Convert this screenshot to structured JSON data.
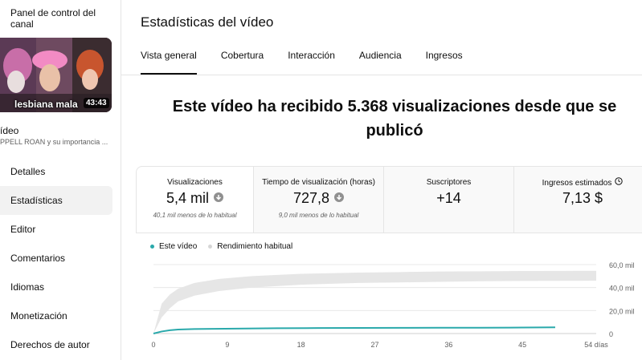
{
  "sidebar": {
    "title": "Panel de control del canal",
    "thumbnail": {
      "overlay_text": "lesbiana mala",
      "duration": "43:43"
    },
    "video_label": "ídeo",
    "video_desc": "PPELL ROAN y su importancia ...",
    "items": [
      {
        "label": "Detalles",
        "active": false
      },
      {
        "label": "Estadísticas",
        "active": true
      },
      {
        "label": "Editor",
        "active": false
      },
      {
        "label": "Comentarios",
        "active": false
      },
      {
        "label": "Idiomas",
        "active": false
      },
      {
        "label": "Monetización",
        "active": false
      },
      {
        "label": "Derechos de autor",
        "active": false
      }
    ]
  },
  "header": {
    "title": "Estadísticas del vídeo"
  },
  "tabs": [
    {
      "label": "Vista general",
      "active": true
    },
    {
      "label": "Cobertura",
      "active": false
    },
    {
      "label": "Interacción",
      "active": false
    },
    {
      "label": "Audiencia",
      "active": false
    },
    {
      "label": "Ingresos",
      "active": false
    }
  ],
  "headline": "Este vídeo ha recibido 5.368 visualizaciones desde que se publicó",
  "cards": [
    {
      "label": "Visualizaciones",
      "value": "5,4 mil",
      "sub": "40,1 mil menos de lo habitual",
      "trend_icon": "arrow-down-icon"
    },
    {
      "label": "Tiempo de visualización (horas)",
      "value": "727,8",
      "sub": "9,0 mil menos de lo habitual",
      "trend_icon": "arrow-down-icon"
    },
    {
      "label": "Suscriptores",
      "value": "+14",
      "sub": ""
    },
    {
      "label": "Ingresos estimados",
      "value": "7,13 $",
      "sub": "",
      "has_info_icon": true
    }
  ],
  "colors": {
    "accent_teal": "#2aa9ab",
    "typical_band": "#e6e6e6"
  },
  "chart_data": {
    "type": "line",
    "legend_placement": "top-left",
    "series": [
      {
        "name": "Este vídeo",
        "color": "#2aa9ab",
        "x": [
          0,
          1,
          2,
          3,
          5,
          10,
          15,
          20,
          25,
          30,
          35,
          40,
          45,
          49
        ],
        "y": [
          0,
          1800,
          2900,
          3500,
          3900,
          4300,
          4600,
          4800,
          4900,
          5000,
          5050,
          5100,
          5200,
          5368
        ]
      },
      {
        "name": "Rendimiento habitual",
        "color": "#e6e6e6",
        "x": [
          0,
          1,
          2,
          3,
          5,
          8,
          12,
          18,
          25,
          30,
          35,
          40,
          45,
          54
        ],
        "y_low": [
          0,
          14000,
          22000,
          28000,
          33000,
          37000,
          40000,
          42500,
          44000,
          44500,
          45000,
          45500,
          45800,
          46000
        ],
        "y_high": [
          0,
          26000,
          34000,
          39000,
          44000,
          47500,
          50000,
          52000,
          53000,
          53500,
          54000,
          54200,
          54400,
          54600
        ]
      }
    ],
    "x_ticks": [
      "0",
      "9",
      "18",
      "27",
      "36",
      "45",
      "54 días"
    ],
    "x_tick_values": [
      0,
      9,
      18,
      27,
      36,
      45,
      54
    ],
    "y_ticks": [
      "0",
      "20,0 mil",
      "40,0 mil",
      "60,0 mil"
    ],
    "y_tick_values": [
      0,
      20000,
      40000,
      60000
    ],
    "xlim": [
      0,
      54
    ],
    "ylim": [
      0,
      60000
    ],
    "grid": true
  }
}
